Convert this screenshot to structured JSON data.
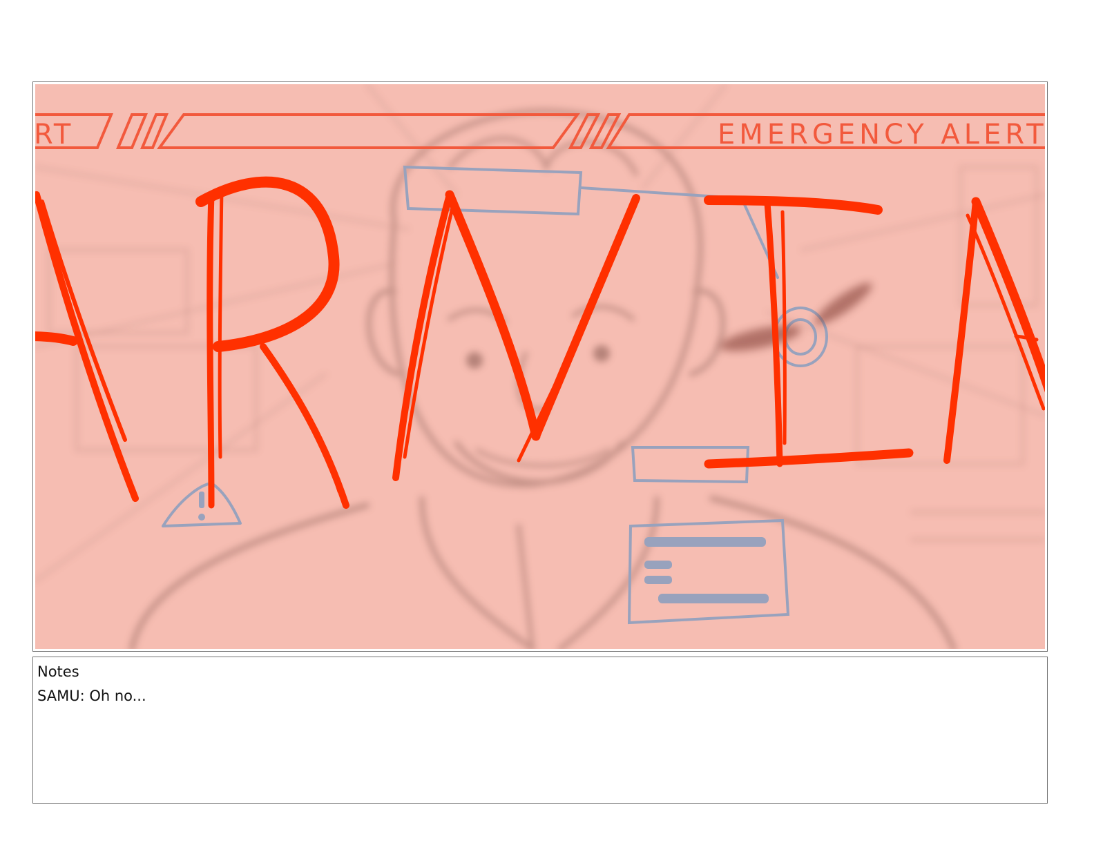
{
  "panel": {
    "banner_text_left": "RT",
    "banner_text_right": "EMERGENCY ALERT",
    "headline_fragment": "ARNIN",
    "colors": {
      "background_wash": "#f6bdb2",
      "sketch_lines": "#b48379",
      "alert_red": "#ff3000",
      "banner_orange": "#f2593c",
      "ui_blue_gray": "#98a2bd",
      "smudge": "#8c4a40"
    }
  },
  "notes": {
    "title": "Notes",
    "line": "SAMU: Oh no..."
  }
}
